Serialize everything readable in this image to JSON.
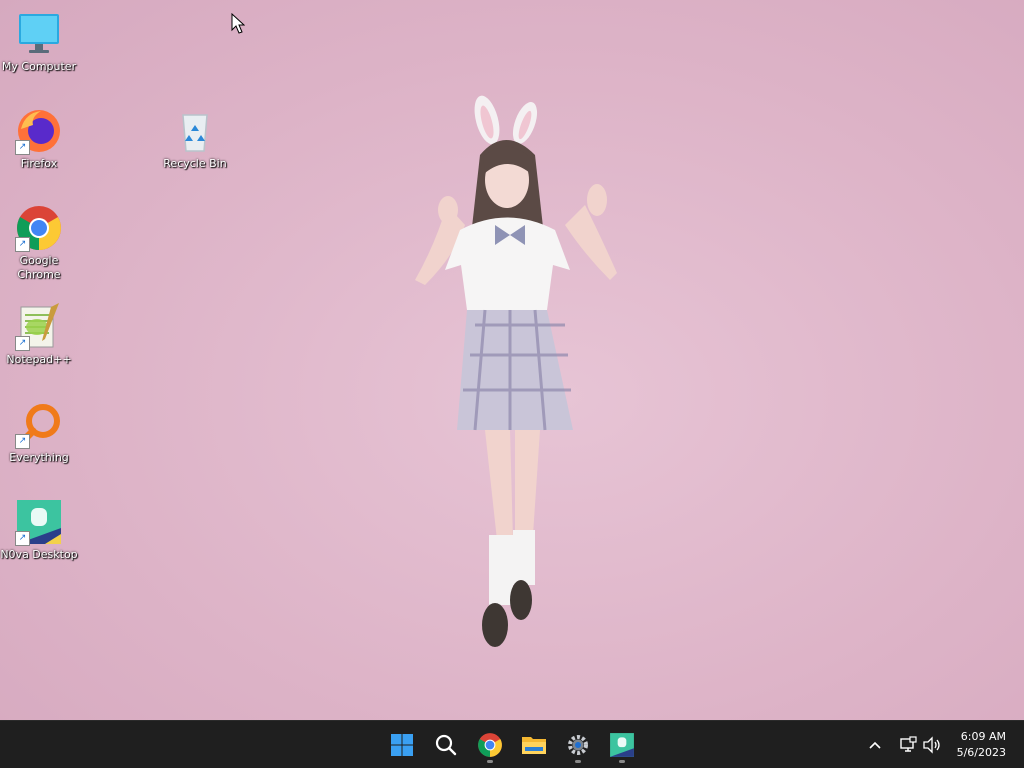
{
  "desktop": {
    "icons": [
      {
        "label": "My Computer",
        "icon": "monitor-icon"
      },
      {
        "label": "Firefox",
        "icon": "firefox-icon"
      },
      {
        "label": "Google Chrome",
        "icon": "chrome-icon"
      },
      {
        "label": "Notepad++",
        "icon": "notepadpp-icon"
      },
      {
        "label": "Everything",
        "icon": "everything-search-icon"
      },
      {
        "label": "N0va Desktop",
        "icon": "n0va-desktop-icon"
      },
      {
        "label": "Recycle Bin",
        "icon": "recycle-bin-icon"
      }
    ],
    "colors": {
      "wallpaper": "#ddb3c7",
      "taskbar": "#1f1f1f"
    }
  },
  "taskbar": {
    "pinned": [
      {
        "icon": "windows-start-icon"
      },
      {
        "icon": "search-icon"
      },
      {
        "icon": "chrome-icon"
      },
      {
        "icon": "file-explorer-icon"
      },
      {
        "icon": "settings-gear-icon"
      },
      {
        "icon": "n0va-desktop-icon"
      }
    ],
    "tray": {
      "icons": [
        "chevron-up-icon",
        "network-icon",
        "volume-icon"
      ]
    },
    "clock": {
      "time": "6:09 AM",
      "date": "5/6/2023"
    }
  }
}
